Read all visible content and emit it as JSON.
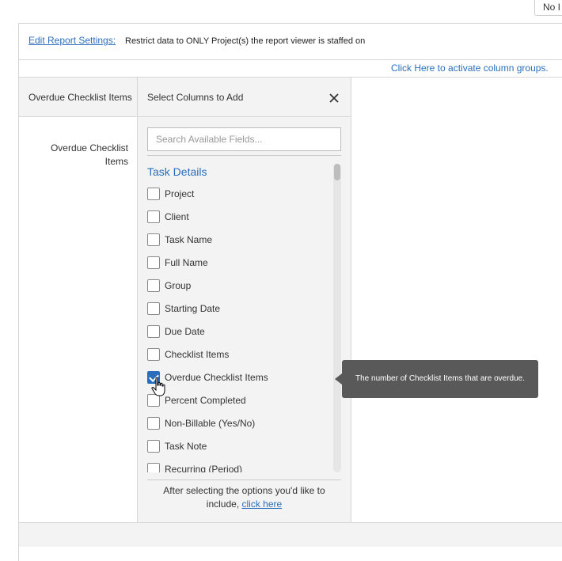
{
  "top_button": {
    "label": "No I"
  },
  "settings": {
    "edit_link": "Edit Report Settings:",
    "restriction": "Restrict data to ONLY Project(s) the report viewer is staffed on"
  },
  "column_groups_link": "Click Here to activate column groups.",
  "report_columns": {
    "header": "Overdue Checklist Items",
    "cell": "Overdue Checklist Items"
  },
  "picker": {
    "title": "Select Columns to Add",
    "close_icon": "close-icon",
    "search_placeholder": "Search Available Fields...",
    "section_title": "Task Details",
    "items": [
      {
        "label": "Project",
        "checked": false
      },
      {
        "label": "Client",
        "checked": false
      },
      {
        "label": "Task Name",
        "checked": false
      },
      {
        "label": "Full Name",
        "checked": false
      },
      {
        "label": "Group",
        "checked": false
      },
      {
        "label": "Starting Date",
        "checked": false
      },
      {
        "label": "Due Date",
        "checked": false
      },
      {
        "label": "Checklist Items",
        "checked": false
      },
      {
        "label": "Overdue Checklist Items",
        "checked": true
      },
      {
        "label": "Percent Completed",
        "checked": false
      },
      {
        "label": "Non-Billable (Yes/No)",
        "checked": false
      },
      {
        "label": "Task Note",
        "checked": false
      },
      {
        "label": "Recurring (Period)",
        "checked": false
      }
    ],
    "footer_text": "After selecting the options you'd like to include,",
    "footer_link": "click here"
  },
  "tooltip": {
    "text": "The number of Checklist Items that are overdue."
  },
  "colors": {
    "accent": "#2a6ebb",
    "panel_bg": "#f3f3f3",
    "tooltip_bg": "#595959",
    "border": "#d6d6d6"
  }
}
